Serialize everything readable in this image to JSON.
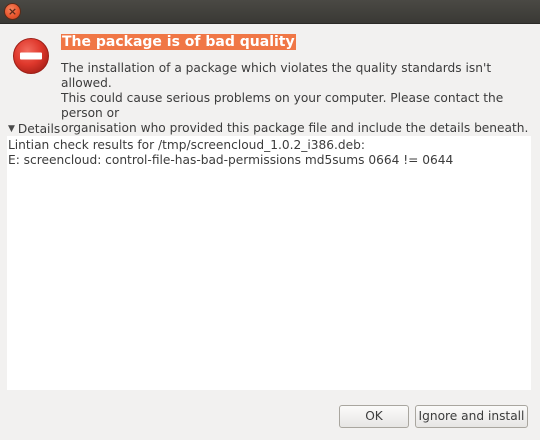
{
  "titlebar": {
    "close_glyph": "×"
  },
  "dialog": {
    "icon": "error-icon",
    "heading": "The package is of bad quality",
    "message_lines": [
      "The installation of a package which violates the quality standards isn't allowed.",
      "This could cause serious problems on your computer. Please contact the person or",
      "organisation who provided this package file and include the details beneath."
    ]
  },
  "details": {
    "expander_glyph": "▼",
    "label": "Details",
    "text": "Lintian check results for /tmp/screencloud_1.0.2_i386.deb:\nE: screencloud: control-file-has-bad-permissions md5sums 0664 != 0644"
  },
  "buttons": {
    "ok_label": "OK",
    "ignore_label": "Ignore and install"
  },
  "colors": {
    "highlight": "#f07746",
    "error_red": "#df382c",
    "window_bg": "#f2f1f0",
    "titlebar_bg": "#3c3b37"
  }
}
